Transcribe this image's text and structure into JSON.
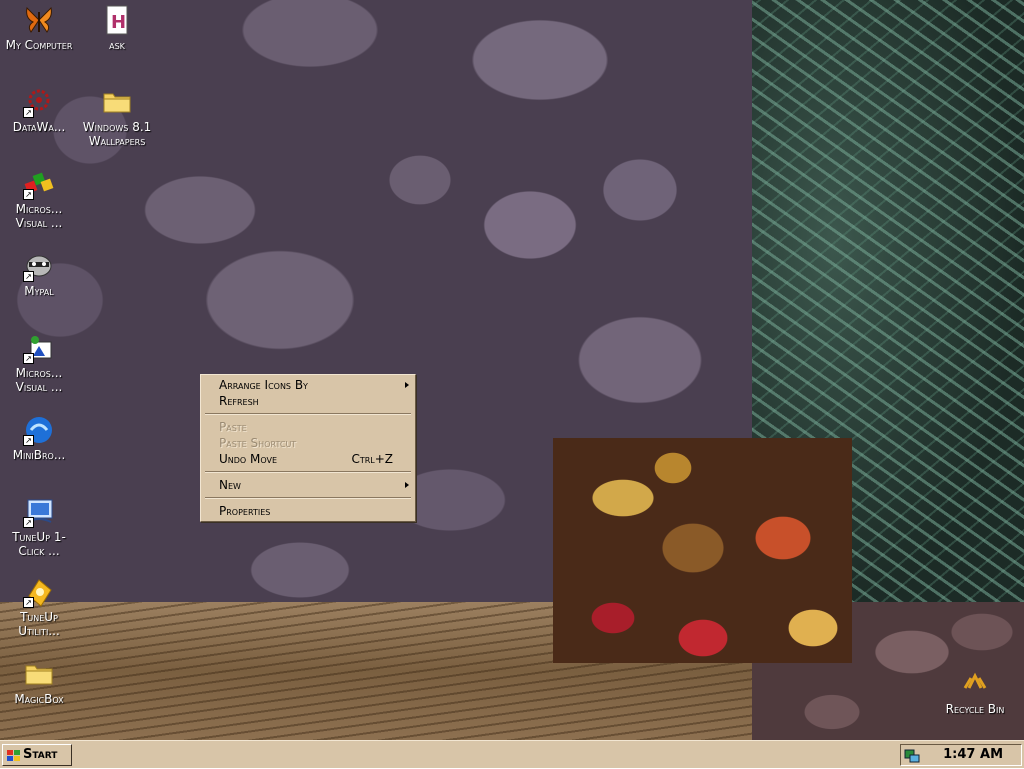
{
  "desktop": {
    "icons": [
      {
        "label": "My Computer",
        "icon": "butterfly-icon"
      },
      {
        "label": "ask",
        "icon": "document-h-icon"
      },
      {
        "label": "DataWa...",
        "icon": "datawarehouse-icon"
      },
      {
        "label": "Windows 8.1 Wallpapers",
        "icon": "folder-icon"
      },
      {
        "label": "Micros... Visual ...",
        "icon": "visual-studio-icon"
      },
      {
        "label": "Mypal",
        "icon": "raccoon-icon"
      },
      {
        "label": "Micros... Visual ...",
        "icon": "visual-foxpro-icon"
      },
      {
        "label": "MiniBro...",
        "icon": "minibrowser-icon"
      },
      {
        "label": "TuneUp 1-Click ...",
        "icon": "tuneup-1click-icon"
      },
      {
        "label": "TuneUp Utiliti...",
        "icon": "tuneup-utilities-icon"
      },
      {
        "label": "MagicBox",
        "icon": "folder-icon"
      },
      {
        "label": "Recycle Bin",
        "icon": "recycle-bin-icon"
      }
    ]
  },
  "context_menu": {
    "arrange_icons_by": "Arrange Icons By",
    "refresh": "Refresh",
    "paste": "Paste",
    "paste_shortcut": "Paste Shortcut",
    "undo_move": "Undo Move",
    "undo_move_shortcut": "Ctrl+Z",
    "new": "New",
    "properties": "Properties"
  },
  "taskbar": {
    "start_label": "Start",
    "clock": "1:47 AM"
  },
  "colors": {
    "taskbar_bg": "#d8c5a8",
    "menu_bg": "#d8c5a8",
    "disabled_text": "#9b8b73"
  }
}
